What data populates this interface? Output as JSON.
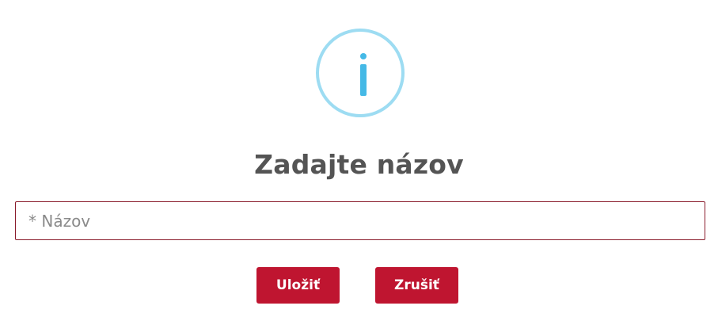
{
  "dialog": {
    "icon": "info-icon",
    "title": "Zadajte názov",
    "name_field": {
      "value": "",
      "placeholder": "* Názov"
    },
    "buttons": {
      "save_label": "Uložiť",
      "cancel_label": "Zrušiť"
    },
    "colors": {
      "icon_ring": "#9ddcf2",
      "icon_glyph": "#45b9e6",
      "button_bg": "#bf1530",
      "input_border": "#8a1c2c",
      "title_text": "#545454"
    }
  }
}
